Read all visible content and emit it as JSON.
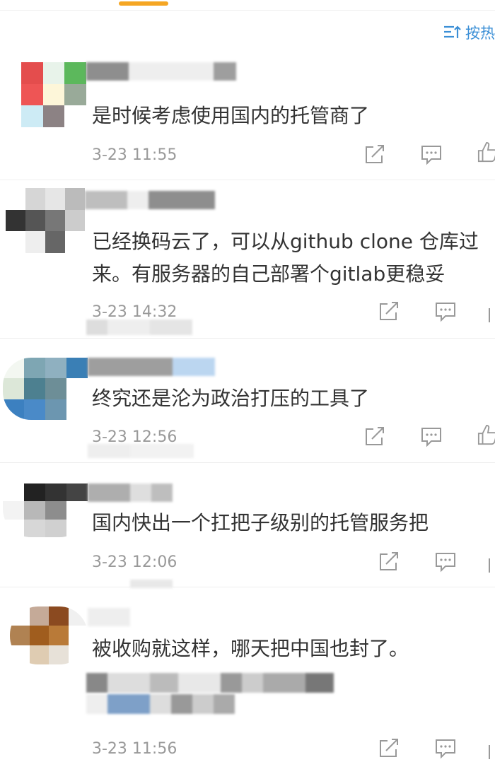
{
  "sort": {
    "label": "按热"
  },
  "comments": [
    {
      "text": "是时候考虑使用国内的托管商了",
      "time": "3-23 11:55"
    },
    {
      "text_line1": "已经换码云了，可以从github clone 仓库过",
      "text_line2": "来。有服务器的自己部署个gitlab更稳妥",
      "time": "3-23 14:32"
    },
    {
      "text": "终究还是沦为政治打压的工具了",
      "time": "3-23 12:56"
    },
    {
      "text": "国内快出一个扛把子级别的托管服务把",
      "time": "3-23 12:06"
    },
    {
      "text": "被收购就这样，哪天把中国也封了。",
      "time": "3-23 11:56"
    }
  ],
  "icons": {
    "share": "share-icon",
    "comment": "comment-icon",
    "like": "like-icon"
  },
  "colors": {
    "accent": "#f5a623",
    "link": "#3b8fd6",
    "meta": "#999999"
  }
}
